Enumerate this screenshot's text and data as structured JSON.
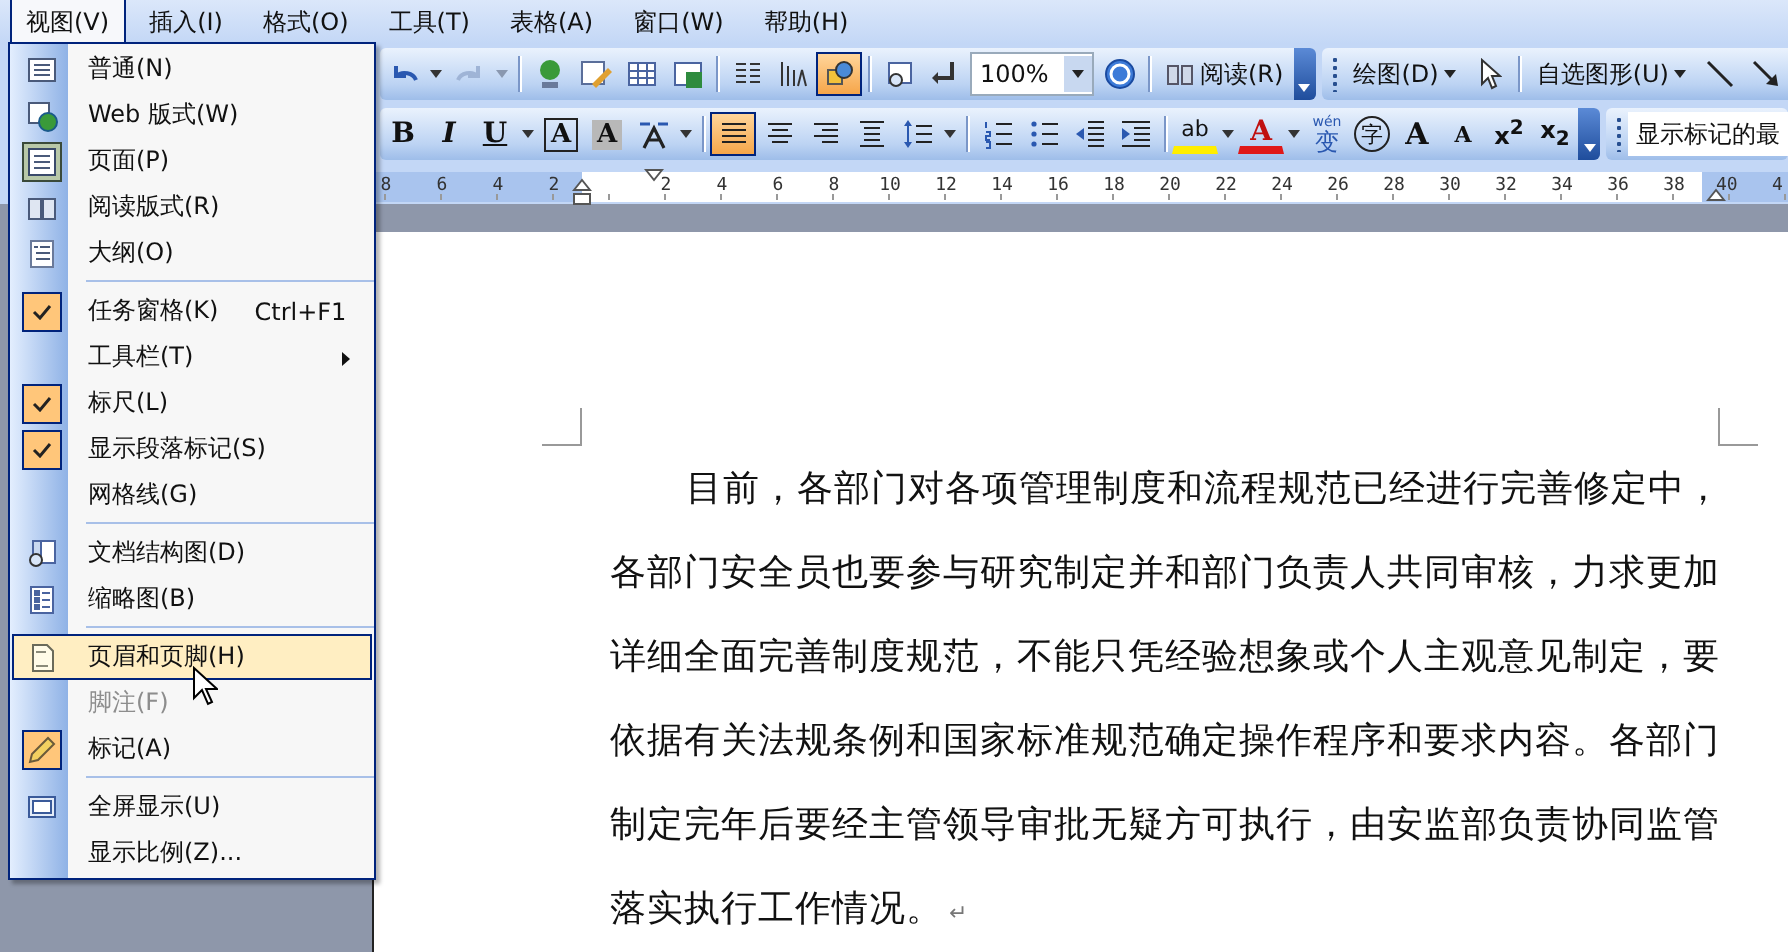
{
  "menu_bar": [
    {
      "label": "视图(V)",
      "selected": true
    },
    {
      "label": "插入(I)",
      "selected": false
    },
    {
      "label": "格式(O)",
      "selected": false
    },
    {
      "label": "工具(T)",
      "selected": false
    },
    {
      "label": "表格(A)",
      "selected": false
    },
    {
      "label": "窗口(W)",
      "selected": false
    },
    {
      "label": "帮助(H)",
      "selected": false
    }
  ],
  "standard_toolbar": {
    "drawing_on": true,
    "zoom": "100%",
    "read_button": "阅读(R)"
  },
  "drawing_toolbar": {
    "draw_menu": "绘图(D)",
    "autoshapes_menu": "自选图形(U)"
  },
  "formatting_toolbar": {
    "bold": "B",
    "italic": "I",
    "underline": "U",
    "char_border": "A",
    "char_shading": "A",
    "align_left_on": true,
    "highlight": "ab",
    "font_color": "A",
    "phonetic_top": "wén",
    "phonetic_char": "变",
    "enclose_char": "字",
    "grow_font": "A",
    "shrink_font": "A",
    "superscript": "x$^{2}$",
    "subscript": "x$_{2}$"
  },
  "reviewing_toolbar": {
    "display_field": "显示标记的最"
  },
  "ruler": {
    "left_margin_labels": [
      "8",
      "6",
      "4",
      "2"
    ],
    "body_labels": [
      "2",
      "4",
      "6",
      "8",
      "10",
      "12",
      "14",
      "16",
      "18",
      "20",
      "22",
      "24",
      "26",
      "28",
      "30",
      "32",
      "34",
      "36",
      "38"
    ],
    "right_margin_labels": [
      "40",
      "4"
    ]
  },
  "view_menu": {
    "groups": [
      {
        "items": [
          {
            "label": "普通(N)",
            "kind": "icon",
            "checked": false,
            "disabled": false,
            "selected": false
          },
          {
            "label": "Web 版式(W)",
            "kind": "icon",
            "checked": false,
            "disabled": false,
            "selected": false
          },
          {
            "label": "页面(P)",
            "kind": "icon",
            "checked": true,
            "disabled": false,
            "selected": false
          },
          {
            "label": "阅读版式(R)",
            "kind": "icon",
            "checked": false,
            "disabled": false,
            "selected": false
          },
          {
            "label": "大纲(O)",
            "kind": "icon",
            "checked": false,
            "disabled": false,
            "selected": false
          }
        ]
      },
      {
        "items": [
          {
            "label": "任务窗格(K)",
            "kind": "plain",
            "checked": true,
            "disabled": false,
            "selected": false,
            "shortcut": "Ctrl+F1"
          },
          {
            "label": "工具栏(T)",
            "kind": "submenu",
            "checked": false,
            "disabled": false,
            "selected": false
          },
          {
            "label": "标尺(L)",
            "kind": "plain",
            "checked": true,
            "disabled": false,
            "selected": false
          },
          {
            "label": "显示段落标记(S)",
            "kind": "plain",
            "checked": true,
            "disabled": false,
            "selected": false
          },
          {
            "label": "网格线(G)",
            "kind": "plain",
            "checked": false,
            "disabled": false,
            "selected": false
          }
        ]
      },
      {
        "items": [
          {
            "label": "文档结构图(D)",
            "kind": "icon",
            "checked": false,
            "disabled": false,
            "selected": false
          },
          {
            "label": "缩略图(B)",
            "kind": "icon",
            "checked": false,
            "disabled": false,
            "selected": false
          }
        ]
      },
      {
        "items": [
          {
            "label": "页眉和页脚(H)",
            "kind": "icon",
            "checked": false,
            "disabled": false,
            "selected": true
          },
          {
            "label": "脚注(F)",
            "kind": "plain",
            "checked": false,
            "disabled": true,
            "selected": false
          },
          {
            "label": "标记(A)",
            "kind": "icon",
            "checked": true,
            "disabled": false,
            "selected": false
          }
        ]
      },
      {
        "items": [
          {
            "label": "全屏显示(U)",
            "kind": "icon",
            "checked": false,
            "disabled": false,
            "selected": false
          },
          {
            "label": "显示比例(Z)...",
            "kind": "plain",
            "checked": false,
            "disabled": false,
            "selected": false
          }
        ]
      }
    ]
  },
  "document": {
    "paragraph_lines": [
      "目前，各部门对各项管理制度和流程规范已经进行完善修定中，",
      "各部门安全员也要参与研究制定并和部门负责人共同审核，力求更加",
      "详细全面完善制度规范，不能只凭经验想象或个人主观意见制定，要",
      "依据有关法规条例和国家标准规范确定操作程序和要求内容。各部门",
      "制定完年后要经主管领导审批无疑方可执行，由安监部负责协同监管",
      "落实执行工作情况。"
    ],
    "paragraph_mark": "↵"
  }
}
